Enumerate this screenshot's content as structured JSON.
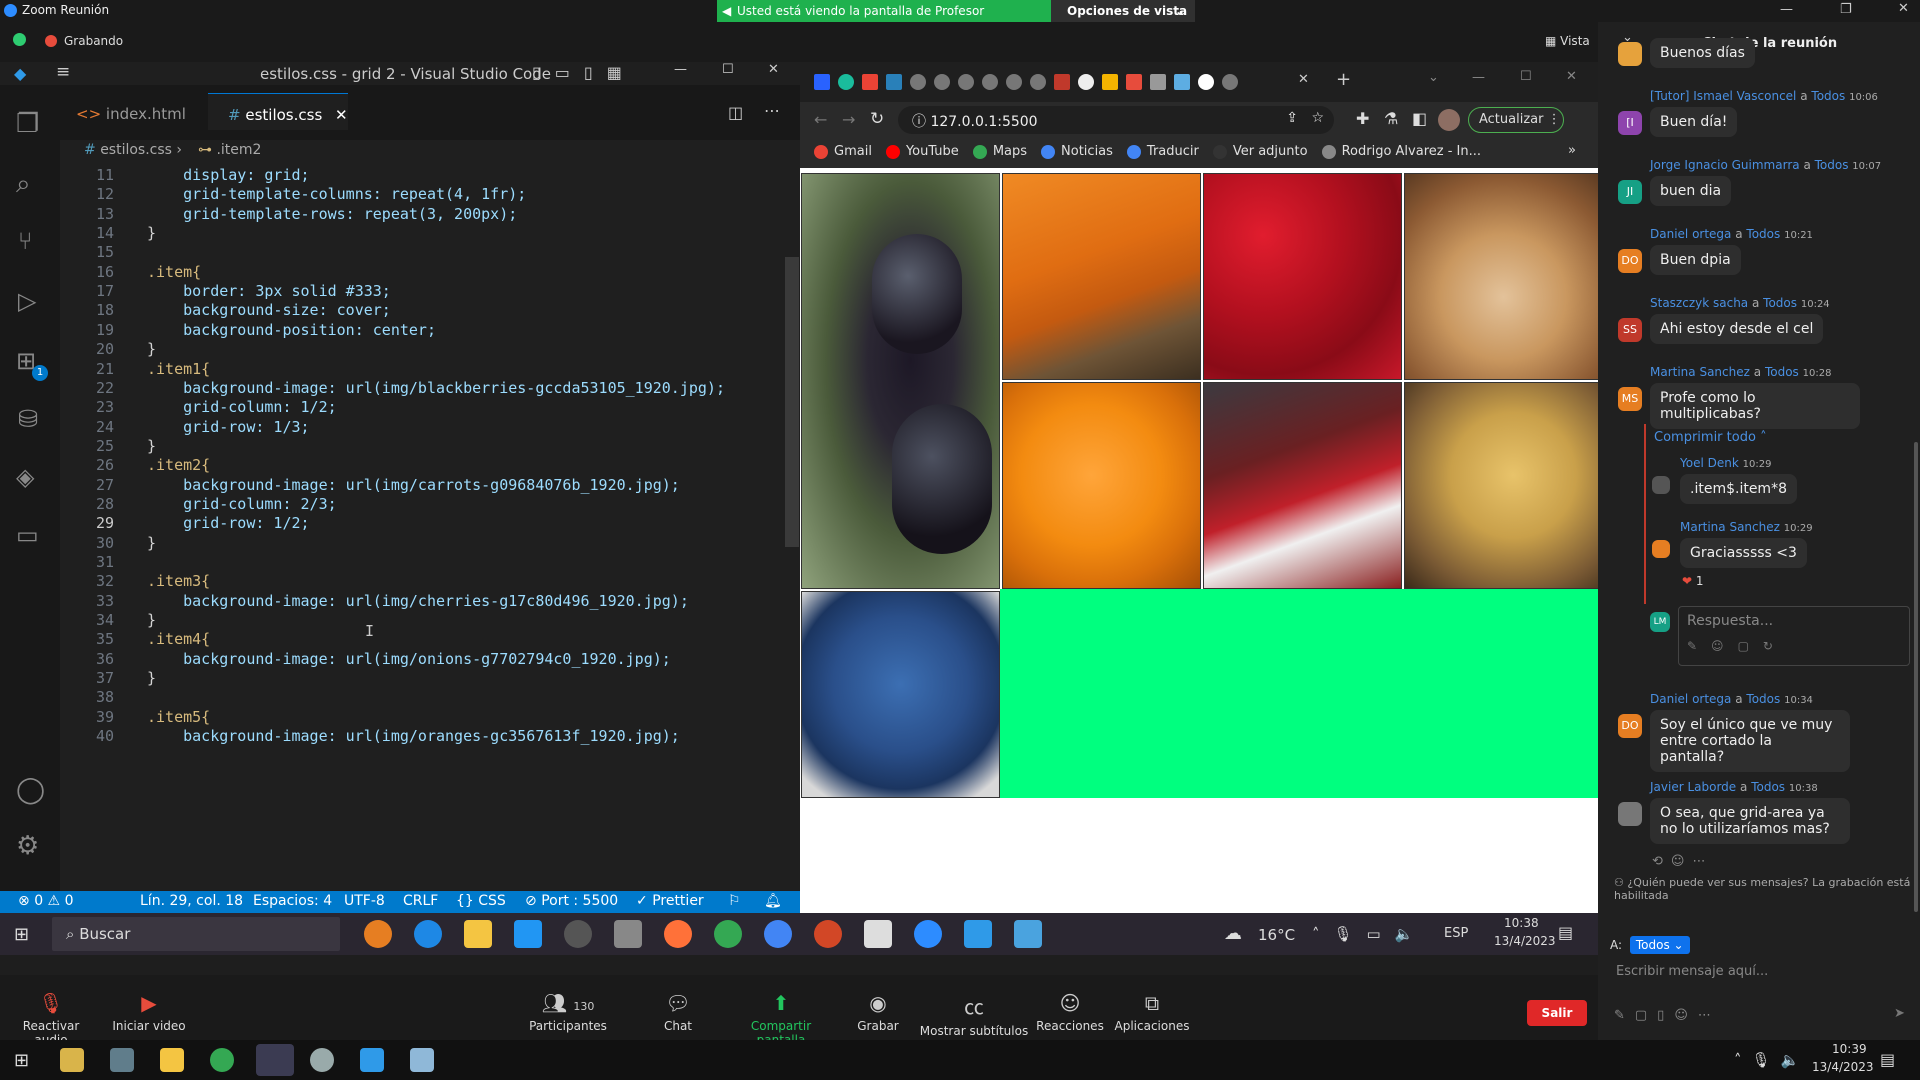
{
  "zoom": {
    "window_title": "Zoom Reunión",
    "share_banner": "Usted está viendo la pantalla de Profesor Coderhouse",
    "view_options": "Opciones de vista",
    "recording": "Grabando",
    "view_label": "Vista",
    "controls": [
      {
        "label": "Reactivar audio",
        "icon": "mic-muted-icon"
      },
      {
        "label": "Iniciar video",
        "icon": "video-off-icon"
      },
      {
        "label": "Participantes",
        "icon": "participants-icon",
        "count": "130"
      },
      {
        "label": "Chat",
        "icon": "chat-icon"
      },
      {
        "label": "Compartir pantalla",
        "icon": "share-screen-icon"
      },
      {
        "label": "Grabar",
        "icon": "record-icon"
      },
      {
        "label": "Mostrar subtítulos",
        "icon": "cc-icon"
      },
      {
        "label": "Reacciones",
        "icon": "reactions-icon"
      },
      {
        "label": "Aplicaciones",
        "icon": "apps-icon"
      }
    ],
    "leave": "Salir"
  },
  "vscode": {
    "title": "estilos.css - grid 2 - Visual Studio Code",
    "tabs": [
      {
        "label": "index.html",
        "icon": "html-icon"
      },
      {
        "label": "estilos.css",
        "icon": "css-icon"
      }
    ],
    "breadcrumb": [
      "estilos.css",
      ".item2"
    ],
    "badge": "1",
    "lines": [
      {
        "n": "11",
        "t": "    display: grid;"
      },
      {
        "n": "12",
        "t": "    grid-template-columns: repeat(4, 1fr);"
      },
      {
        "n": "13",
        "t": "    grid-template-rows: repeat(3, 200px);"
      },
      {
        "n": "14",
        "t": "}"
      },
      {
        "n": "15",
        "t": ""
      },
      {
        "n": "16",
        "t": ".item{"
      },
      {
        "n": "17",
        "t": "    border: 3px solid #333;"
      },
      {
        "n": "18",
        "t": "    background-size: cover;"
      },
      {
        "n": "19",
        "t": "    background-position: center;"
      },
      {
        "n": "20",
        "t": "}"
      },
      {
        "n": "21",
        "t": ".item1{"
      },
      {
        "n": "22",
        "t": "    background-image: url(img/blackberries-gccda53105_1920.jpg);"
      },
      {
        "n": "23",
        "t": "    grid-column: 1/2;"
      },
      {
        "n": "24",
        "t": "    grid-row: 1/3;"
      },
      {
        "n": "25",
        "t": "}"
      },
      {
        "n": "26",
        "t": ".item2{"
      },
      {
        "n": "27",
        "t": "    background-image: url(img/carrots-g09684076b_1920.jpg);"
      },
      {
        "n": "28",
        "t": "    grid-column: 2/3;"
      },
      {
        "n": "29",
        "t": "    grid-row: 1/2;"
      },
      {
        "n": "30",
        "t": "}"
      },
      {
        "n": "31",
        "t": ""
      },
      {
        "n": "32",
        "t": ".item3{"
      },
      {
        "n": "33",
        "t": "    background-image: url(img/cherries-g17c80d496_1920.jpg);"
      },
      {
        "n": "34",
        "t": "}"
      },
      {
        "n": "35",
        "t": ".item4{"
      },
      {
        "n": "36",
        "t": "    background-image: url(img/onions-g7702794c0_1920.jpg);"
      },
      {
        "n": "37",
        "t": "}"
      },
      {
        "n": "38",
        "t": ""
      },
      {
        "n": "39",
        "t": ".item5{"
      },
      {
        "n": "40",
        "t": "    background-image: url(img/oranges-gc3567613f_1920.jpg);"
      }
    ],
    "status": {
      "errors": "0",
      "warnings": "0",
      "position": "Lín. 29, col. 18",
      "spaces": "Espacios: 4",
      "encoding": "UTF-8",
      "eol": "CRLF",
      "language": "CSS",
      "port": "Port : 5500",
      "prettier": "Prettier"
    }
  },
  "browser": {
    "address": "127.0.0.1:5500",
    "update": "Actualizar",
    "bookmarks": [
      "Gmail",
      "YouTube",
      "Maps",
      "Noticias",
      "Traducir",
      "Ver adjunto",
      "Rodrigo Alvarez - In..."
    ],
    "grid_items": [
      "blackberries",
      "carrots",
      "cherries",
      "onions",
      "oranges",
      "strawberries",
      "potatoes",
      "blueberries"
    ],
    "accent": "#00ff7f"
  },
  "chat": {
    "title": "Chat de la reunión",
    "messages": [
      {
        "name": "",
        "to": "",
        "time": "",
        "text": "Buenos días",
        "avatar": "",
        "color": "#e6a23c"
      },
      {
        "name": "[Tutor] Ismael Vasconcel",
        "to": "Todos",
        "time": "10:06",
        "text": "Buen día!",
        "avatar": "[I",
        "color": "#8e44ad"
      },
      {
        "name": "Jorge Ignacio Guimmarra",
        "to": "Todos",
        "time": "10:07",
        "text": "buen dia",
        "avatar": "JI",
        "color": "#16a085"
      },
      {
        "name": "Daniel ortega",
        "to": "Todos",
        "time": "10:21",
        "text": "Buen dpia",
        "avatar": "DO",
        "color": "#e67e22"
      },
      {
        "name": "Staszczyk sacha",
        "to": "Todos",
        "time": "10:24",
        "text": "Ahi estoy desde el cel",
        "avatar": "SS",
        "color": "#c0392b"
      },
      {
        "name": "Martina Sanchez",
        "to": "Todos",
        "time": "10:28",
        "text": "Profe como lo multiplicabas?",
        "avatar": "MS",
        "color": "#e67e22"
      }
    ],
    "collapse": "Comprimir todo",
    "replies": [
      {
        "name": "Yoel Denk",
        "time": "10:29",
        "text": ".item$.item*8"
      },
      {
        "name": "Martina Sanchez",
        "time": "10:29",
        "text": "Graciasssss <3"
      }
    ],
    "reaction": "1",
    "reply_placeholder": "Respuesta...",
    "reply_avatar": "LM",
    "messages2": [
      {
        "name": "Daniel ortega",
        "to": "Todos",
        "time": "10:34",
        "text": "Soy el único que ve muy entre cortado la pantalla?",
        "avatar": "DO",
        "color": "#e67e22"
      },
      {
        "name": "Javier Laborde",
        "to": "Todos",
        "time": "10:38",
        "text": "O sea, que grid-area ya no lo utilizaríamos mas?",
        "avatar": "",
        "color": "#777"
      }
    ],
    "who_sees": "¿Quién puede ver sus mensajes? La grabación está habilitada",
    "to_label": "A:",
    "to_value": "Todos",
    "input_placeholder": "Escribir mensaje aquí..."
  },
  "taskbar1": {
    "search": "Buscar",
    "weather": "16°C",
    "lang": "ESP",
    "time": "10:38",
    "date": "13/4/2023"
  },
  "taskbar2": {
    "time": "10:39",
    "date": "13/4/2023"
  }
}
